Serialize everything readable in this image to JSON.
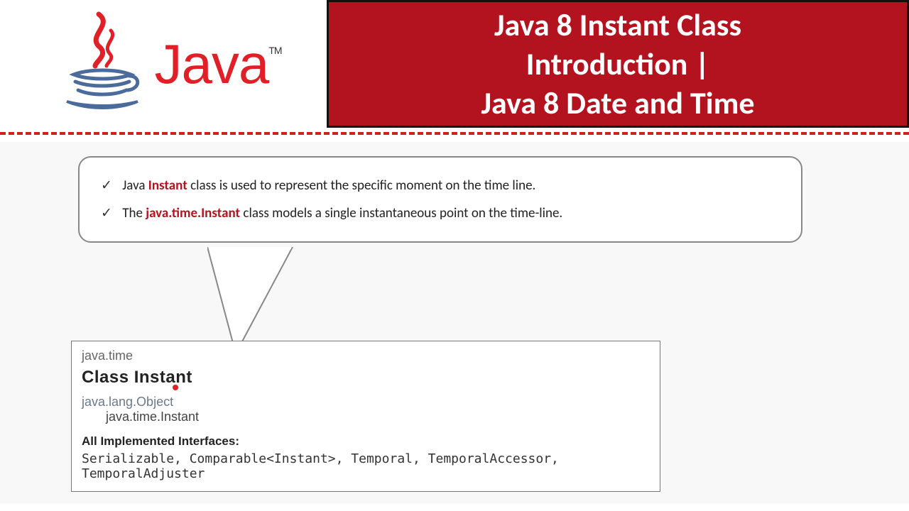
{
  "header": {
    "logo_word": "Java",
    "tm": "TM",
    "title_line1": "Java 8 Instant Class",
    "title_line2": "Introduction |",
    "title_line3": "Java 8 Date and Time"
  },
  "bullets": {
    "b1_pre": "Java ",
    "b1_hl": "Instant",
    "b1_post": " class is used to represent the specific moment on the time line.",
    "b2_pre": "The ",
    "b2_hl": "java.time.Instant",
    "b2_post": " class models a single instantaneous point on the time-line."
  },
  "classbox": {
    "package": "java.time",
    "class_label": "Class Instant",
    "hier1": "java.lang.Object",
    "hier2": "java.time.Instant",
    "iface_label": "All Implemented Interfaces:",
    "iface_list": "Serializable, Comparable<Instant>, Temporal, TemporalAccessor, TemporalAdjuster"
  }
}
